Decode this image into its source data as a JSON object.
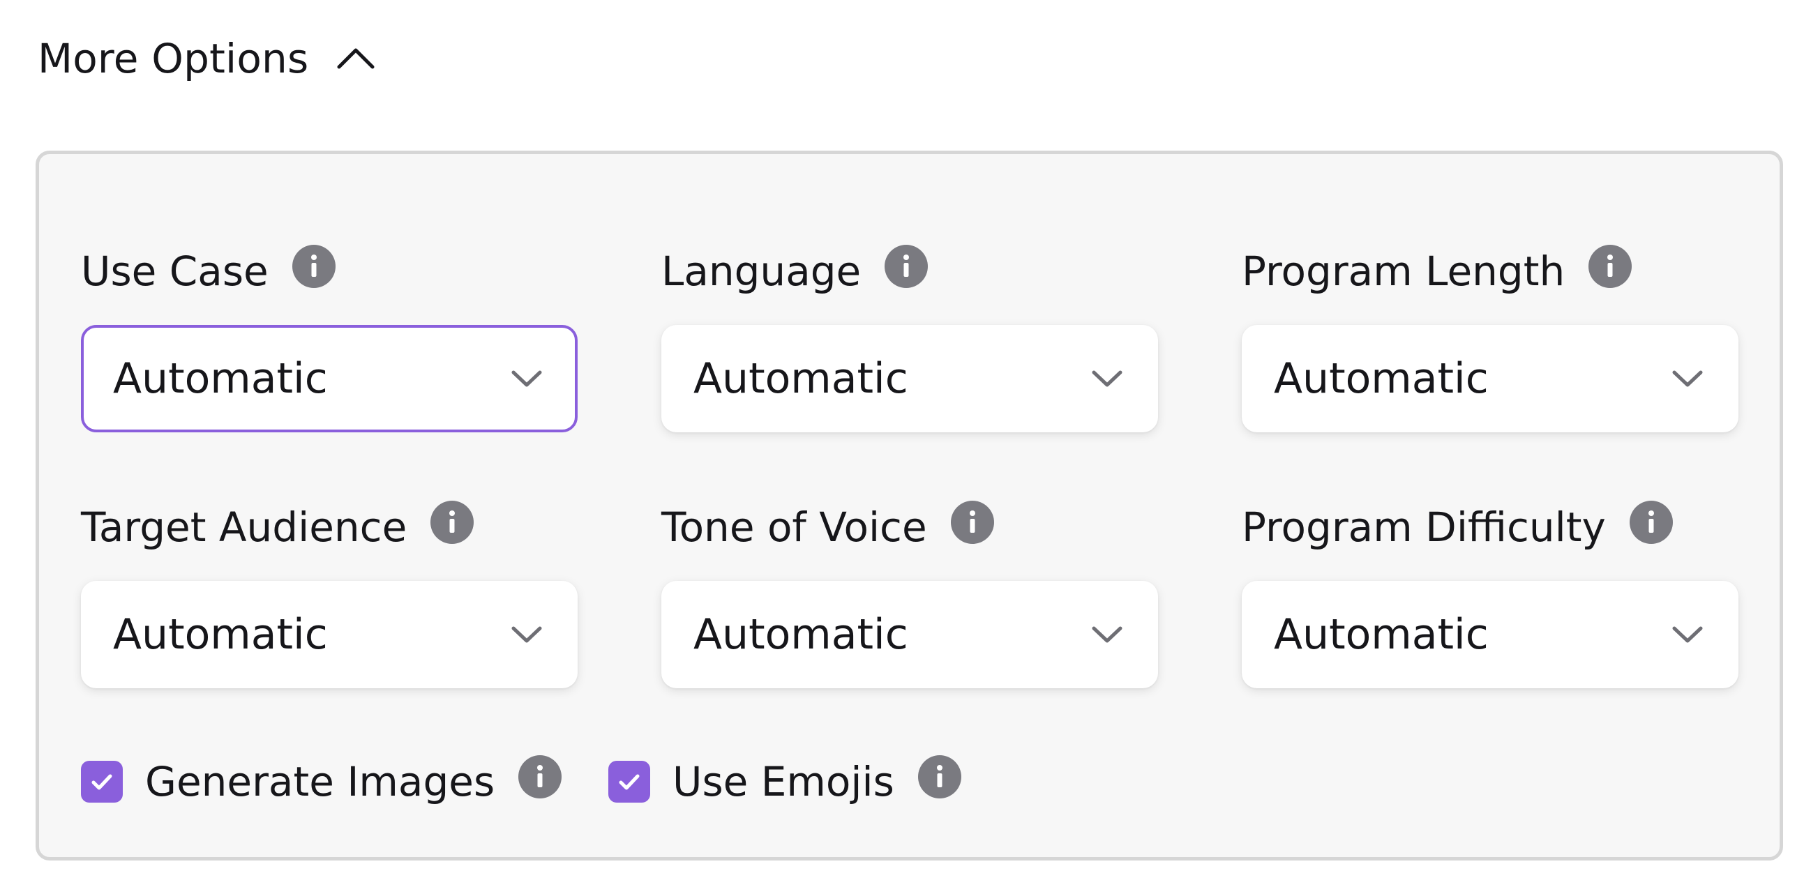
{
  "toggle": {
    "label": "More Options",
    "expanded": true
  },
  "fields": [
    {
      "id": "use-case",
      "label": "Use Case",
      "value": "Automatic",
      "focused": true
    },
    {
      "id": "language",
      "label": "Language",
      "value": "Automatic",
      "focused": false
    },
    {
      "id": "program-length",
      "label": "Program Length",
      "value": "Automatic",
      "focused": false
    },
    {
      "id": "target-audience",
      "label": "Target Audience",
      "value": "Automatic",
      "focused": false
    },
    {
      "id": "tone-of-voice",
      "label": "Tone of Voice",
      "value": "Automatic",
      "focused": false
    },
    {
      "id": "program-difficulty",
      "label": "Program Difficulty",
      "value": "Automatic",
      "focused": false
    }
  ],
  "checkboxes": [
    {
      "id": "generate-images",
      "label": "Generate Images",
      "checked": true
    },
    {
      "id": "use-emojis",
      "label": "Use Emojis",
      "checked": true
    }
  ],
  "colors": {
    "accent": "#8a5fdc",
    "info_icon": "#7a7a80",
    "panel_bg": "#f7f7f7",
    "panel_border": "#d6d6d6"
  },
  "icons": {
    "toggle": "chevron-up-icon",
    "select": "chevron-down-icon",
    "info": "info-icon",
    "check": "checkmark-icon"
  }
}
